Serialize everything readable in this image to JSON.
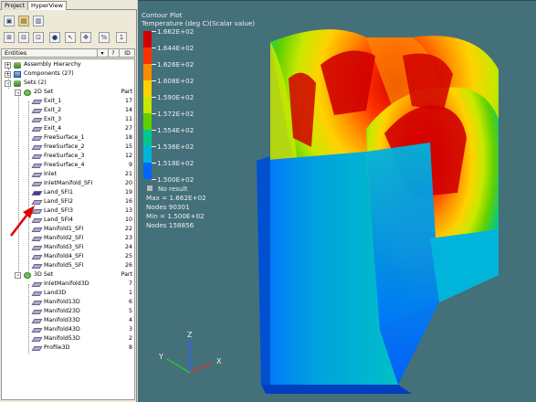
{
  "tabs": [
    "Project",
    "HyperView"
  ],
  "toolbar": {
    "buttons": [
      "select-icon",
      "isolate-icon",
      "show-icon",
      "graph-icon",
      "sphere-icon",
      "cursor-icon",
      "move-icon",
      "percent-icon",
      "one-icon"
    ]
  },
  "entities_header": {
    "label": "Entities",
    "help_icon": "help-icon",
    "id_label": "ID"
  },
  "tree": {
    "assembly": "Assembly Hierarchy",
    "components": "Components (27)",
    "sets": "Sets (2)",
    "set_2d": {
      "label": "2D Set",
      "type": "Part"
    },
    "items_2d": [
      {
        "name": "Exit_1",
        "id": "17"
      },
      {
        "name": "Exit_2",
        "id": "14"
      },
      {
        "name": "Exit_3",
        "id": "11"
      },
      {
        "name": "Exit_4",
        "id": "27"
      },
      {
        "name": "FreeSurface_1",
        "id": "18"
      },
      {
        "name": "FreeSurface_2",
        "id": "15"
      },
      {
        "name": "FreeSurface_3",
        "id": "12"
      },
      {
        "name": "FreeSurface_4",
        "id": "9"
      },
      {
        "name": "Inlet",
        "id": "21"
      },
      {
        "name": "InletManifold_SFI",
        "id": "20"
      },
      {
        "name": "Land_SFI1",
        "id": "19"
      },
      {
        "name": "Land_SFI2",
        "id": "16"
      },
      {
        "name": "Land_SFI3",
        "id": "13"
      },
      {
        "name": "Land_SFI4",
        "id": "10"
      },
      {
        "name": "Manifold1_SFI",
        "id": "22"
      },
      {
        "name": "Manifold2_SFI",
        "id": "23"
      },
      {
        "name": "Manifold3_SFI",
        "id": "24"
      },
      {
        "name": "Manifold4_SFI",
        "id": "25"
      },
      {
        "name": "Manifold5_SFI",
        "id": "26"
      }
    ],
    "set_3d": {
      "label": "3D Set",
      "type": "Part"
    },
    "items_3d": [
      {
        "name": "InletManifold3D",
        "id": "7"
      },
      {
        "name": "Land3D",
        "id": "1"
      },
      {
        "name": "Manifold13D",
        "id": "6"
      },
      {
        "name": "Manifold23D",
        "id": "5"
      },
      {
        "name": "Manifold33D",
        "id": "4"
      },
      {
        "name": "Manifold43D",
        "id": "3"
      },
      {
        "name": "Manifold53D",
        "id": "2"
      },
      {
        "name": "Profile3D",
        "id": "8"
      }
    ]
  },
  "legend": {
    "title": "Contour Plot",
    "subtitle": "Temperature (deg C)(Scalar value)",
    "values": [
      "1.662E+02",
      "1.644E+02",
      "1.626E+02",
      "1.608E+02",
      "1.590E+02",
      "1.572E+02",
      "1.554E+02",
      "1.536E+02",
      "1.518E+02",
      "1.500E+02"
    ],
    "colors": [
      "#d00000",
      "#ff3000",
      "#ff8c00",
      "#ffd200",
      "#c8e800",
      "#5fd000",
      "#00c88c",
      "#00b4dc",
      "#0064ff",
      "#0000c0"
    ],
    "no_result": "No result",
    "no_result_color": "#b8b8b8",
    "max_line": "Max = 1.662E+02",
    "max_nodes": "Nodes 90301",
    "min_line": "Min = 1.500E+02",
    "min_nodes": "Nodes 158856"
  },
  "triad": {
    "x": "X",
    "y": "Y",
    "z": "Z"
  }
}
